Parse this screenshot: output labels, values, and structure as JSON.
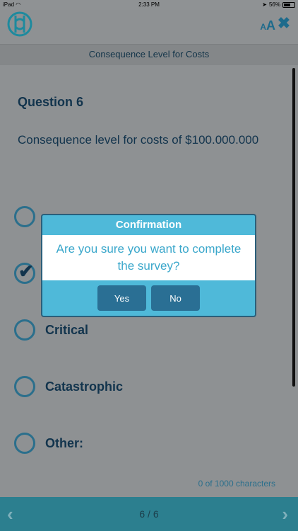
{
  "status_bar": {
    "device": "iPad",
    "time": "2:33 PM",
    "battery": "56%"
  },
  "header": {
    "font_size_label_small": "A",
    "font_size_label_big": "A",
    "close_icon": "✖"
  },
  "subheader": {
    "title": "Consequence Level for Costs"
  },
  "question": {
    "number": "Question 6",
    "text": "Consequence level for costs of $100.000.000",
    "options": [
      {
        "label": "",
        "selected": false
      },
      {
        "label": "",
        "selected": true
      },
      {
        "label": "Critical",
        "selected": false
      },
      {
        "label": "Catastrophic",
        "selected": false
      },
      {
        "label": "Other:",
        "selected": false
      }
    ],
    "char_count": "0 of 1000 characters"
  },
  "footer": {
    "prev_icon": "‹",
    "page_indicator": "6 / 6",
    "next_icon": "›"
  },
  "dialog": {
    "title": "Confirmation",
    "message": "Are you sure you want to complete the survey?",
    "yes_label": "Yes",
    "no_label": "No"
  },
  "colors": {
    "accent": "#2c7f8f",
    "dialog_bg": "#4fb9d9",
    "button": "#2a6f94",
    "text_dark": "#12344d"
  }
}
